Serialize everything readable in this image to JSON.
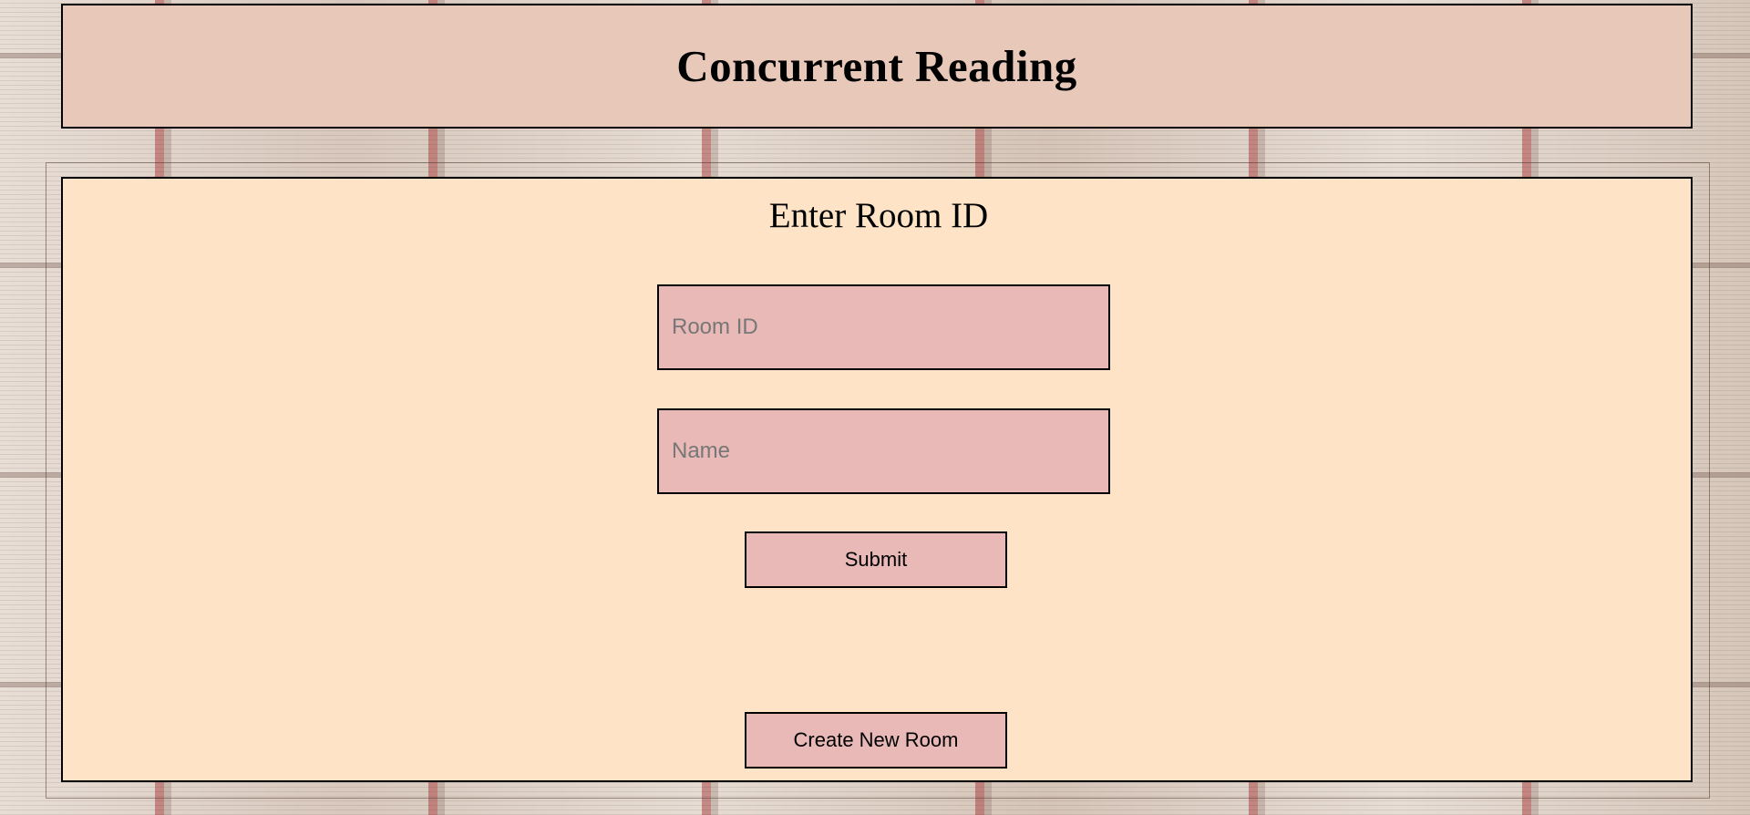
{
  "header": {
    "title": "Concurrent Reading"
  },
  "join_form": {
    "title": "Enter Room ID",
    "room_id": {
      "value": "",
      "placeholder": "Room ID"
    },
    "name": {
      "value": "",
      "placeholder": "Name"
    },
    "submit_label": "Submit"
  },
  "create_room_label": "Create New Room",
  "colors": {
    "header_bg": "#e8c8b9",
    "panel_bg": "#fee3c6",
    "control_bg": "#e8b9b6",
    "border": "#000000",
    "placeholder": "#777777"
  }
}
